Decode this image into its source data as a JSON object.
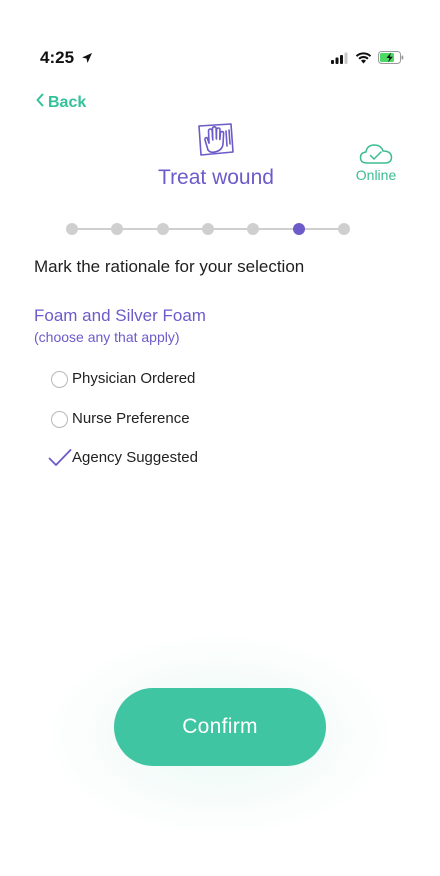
{
  "status_bar": {
    "time": "4:25",
    "icons": [
      "location-arrow-icon",
      "signal-icon",
      "wifi-icon",
      "battery-charging-icon"
    ]
  },
  "nav": {
    "back_label": "Back"
  },
  "header": {
    "icon": "hand-wipe-icon",
    "title": "Treat wound",
    "connection_status": "Online",
    "connection_icon": "cloud-check-icon"
  },
  "stepper": {
    "total_steps": 7,
    "current_step": 6
  },
  "prompt": "Mark the rationale for your selection",
  "section": {
    "title": "Foam and Silver Foam",
    "hint": "(choose any that apply)",
    "options": [
      {
        "label": "Physician Ordered",
        "selected": false
      },
      {
        "label": "Nurse Preference",
        "selected": false
      },
      {
        "label": "Agency Suggested",
        "selected": true
      }
    ]
  },
  "actions": {
    "confirm_label": "Confirm"
  },
  "colors": {
    "accent_green": "#3fc5a2",
    "accent_purple": "#6c5bc9",
    "inactive_grey": "#cfcfcf"
  }
}
